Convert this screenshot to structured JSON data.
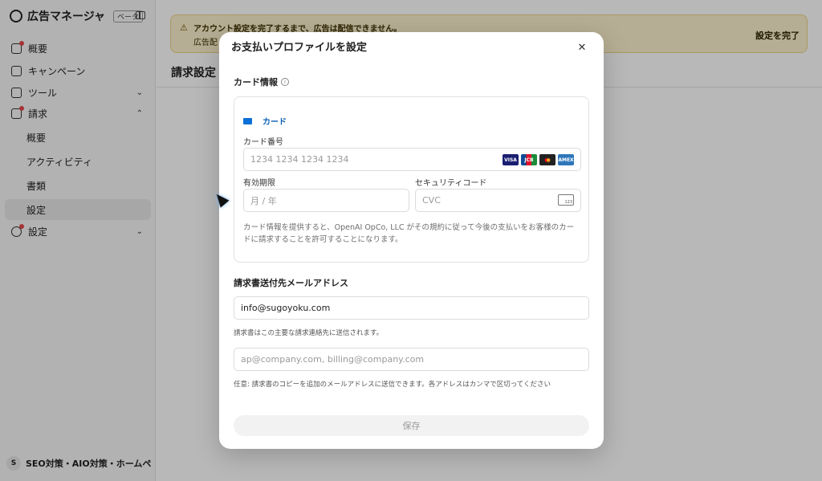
{
  "sidebar": {
    "brand_title": "広告マネージャ",
    "brand_badge": "ベータ",
    "items": [
      {
        "label": "概要",
        "icon": "home-icon"
      },
      {
        "label": "キャンペーン",
        "icon": "megaphone-icon"
      },
      {
        "label": "ツール",
        "icon": "toolbox-icon"
      },
      {
        "label": "請求",
        "icon": "billing-icon"
      },
      {
        "label": "設定",
        "icon": "gear-icon"
      }
    ],
    "billing_sub": [
      "概要",
      "アクティビティ",
      "書類",
      "設定"
    ],
    "account_initial": "S",
    "account_name": "SEO対策・AIO対策・ホームページ..."
  },
  "banner": {
    "message": "アカウント設定を完了するまで、広告は配信できません。",
    "message2": "広告配",
    "action": "設定を完了"
  },
  "main": {
    "title": "請求設定"
  },
  "modal": {
    "title": "お支払いプロファイルを設定",
    "card_section_label": "カード情報",
    "card_tab_label": "カード",
    "card_number_label": "カード番号",
    "card_number_placeholder": "1234 1234 1234 1234",
    "expiry_label": "有効期限",
    "expiry_placeholder": "月 / 年",
    "security_label": "セキュリティコード",
    "cvc_placeholder": "CVC",
    "cvc_icon_text": "123",
    "card_brands": [
      "VISA",
      "JCB",
      "MC",
      "AMEX"
    ],
    "consent": "カード情報を提供すると、OpenAI OpCo, LLC がその規約に従って今後の支払いをお客様のカードに請求することを許可することになります。",
    "email_section_title": "請求書送付先メールアドレス",
    "primary_email_value": "info@sugoyoku.com",
    "primary_email_help": "請求書はこの主要な請求連絡先に送信されます。",
    "additional_email_placeholder": "ap@company.com, billing@company.com",
    "additional_email_help": "任意: 請求書のコピーを追加のメールアドレスに送信できます。各アドレスはカンマで区切ってください",
    "save_label": "保存"
  }
}
